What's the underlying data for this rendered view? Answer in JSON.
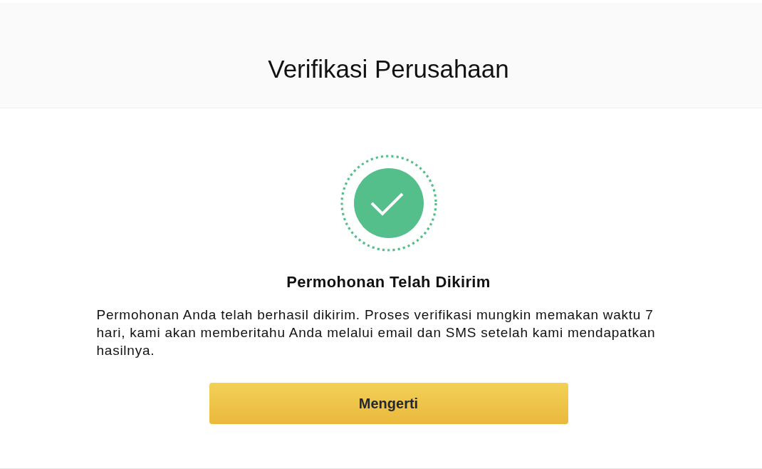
{
  "header": {
    "title": "Verifikasi Perusahaan"
  },
  "result": {
    "heading": "Permohonan Telah Dikirim",
    "message": "Permohonan Anda telah berhasil dikirim. Proses verifikasi mungkin memakan waktu 7 hari, kami akan memberitahu Anda melalui email dan SMS setelah kami mendapatkan hasilnya."
  },
  "buttons": [
    {
      "label": "Mengerti"
    }
  ]
}
